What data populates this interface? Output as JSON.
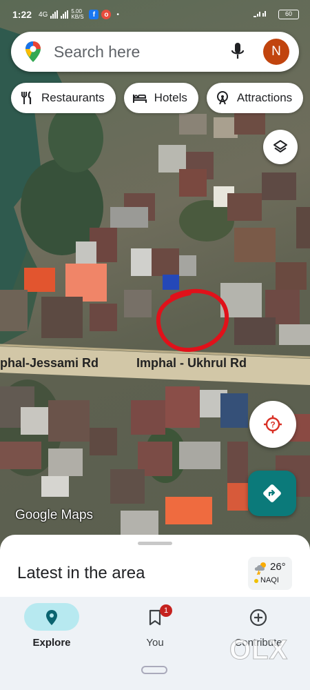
{
  "status_bar": {
    "time": "1:22",
    "network": "4G",
    "data_speed": "5.00 KB/S",
    "battery": "60"
  },
  "search": {
    "placeholder": "Search here",
    "avatar_initial": "N"
  },
  "chips": [
    {
      "label": "Restaurants",
      "icon": "fork-knife-icon"
    },
    {
      "label": "Hotels",
      "icon": "bed-icon"
    },
    {
      "label": "Attractions",
      "icon": "ferris-wheel-icon"
    }
  ],
  "map": {
    "road_left": "phal-Jessami Rd",
    "road_right": "Imphal - Ukhrul Rd",
    "logo": "Google Maps"
  },
  "sheet": {
    "title": "Latest in the area",
    "weather_temp": "26°",
    "aqi_label": "NAQI"
  },
  "nav": [
    {
      "label": "Explore",
      "icon": "explore-pin-icon",
      "active": true
    },
    {
      "label": "You",
      "icon": "bookmark-icon",
      "badge": "1"
    },
    {
      "label": "Contribute",
      "icon": "add-circle-icon"
    }
  ],
  "watermark": "OLX",
  "colors": {
    "accent": "#0b7a7a",
    "avatar": "#c1440e",
    "explore_pill": "#b7e9f0",
    "annotation_circle": "#e0111a"
  }
}
